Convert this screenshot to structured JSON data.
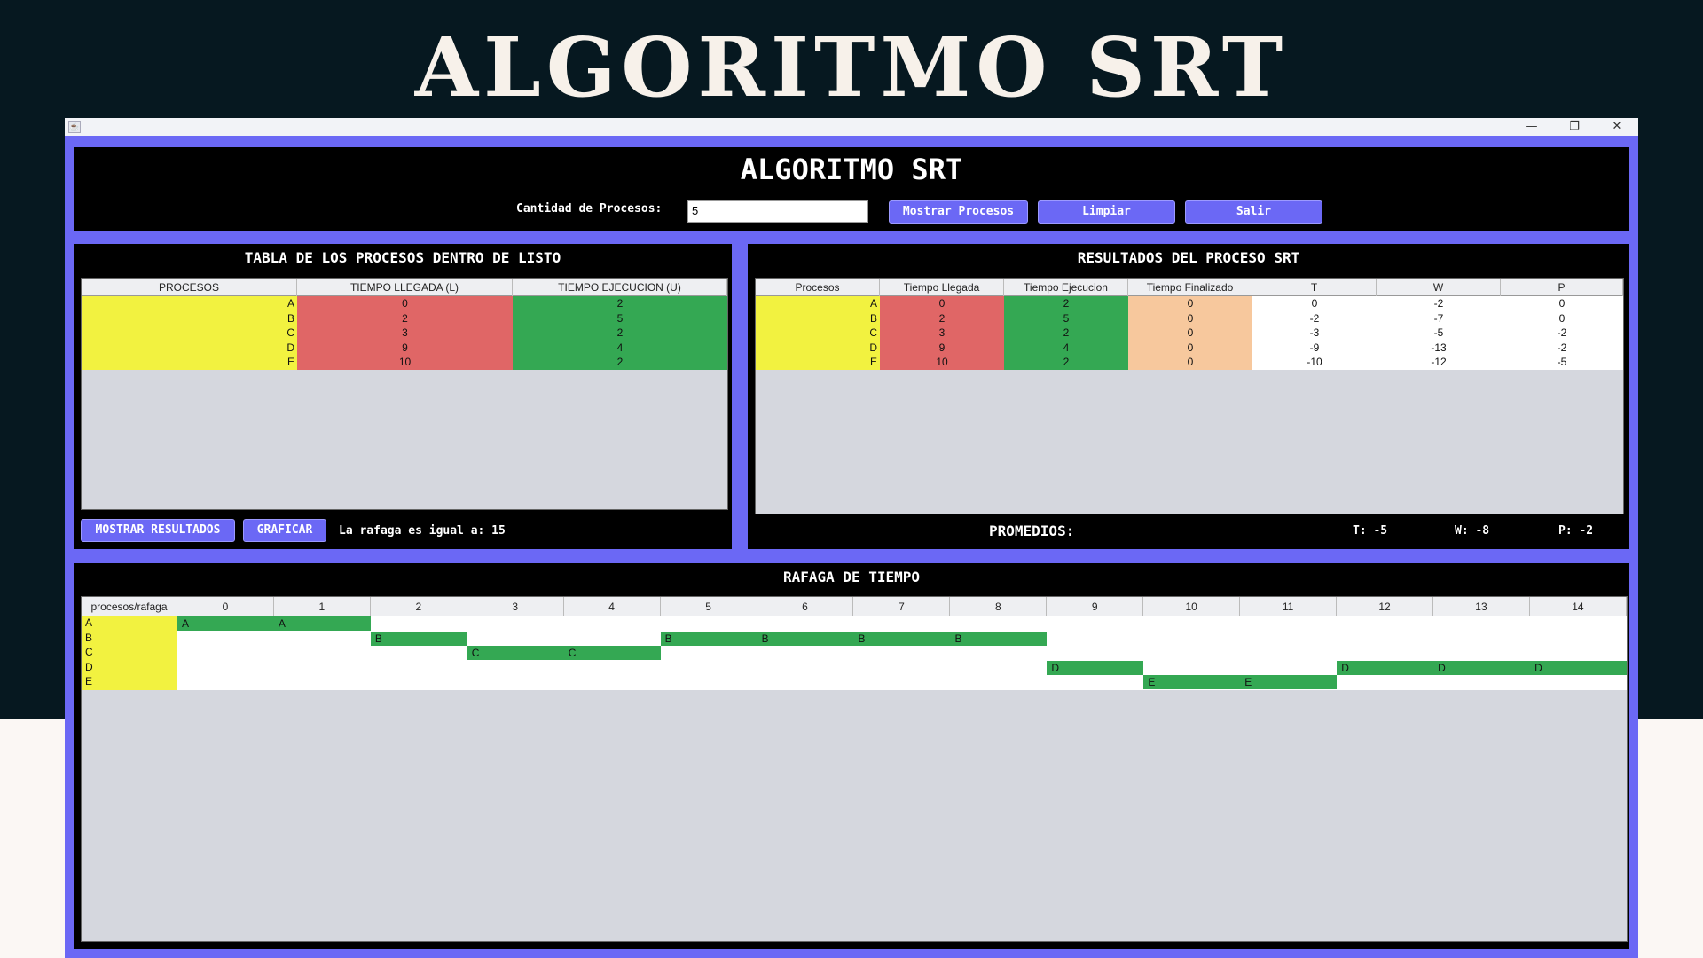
{
  "page_title": "ALGORITMO SRT",
  "window": {
    "minimize_icon": "minimize-icon",
    "restore_icon": "restore-icon",
    "close_icon": "close-icon"
  },
  "header": {
    "title": "ALGORITMO SRT",
    "qty_label": "Cantidad de Procesos:",
    "qty_value": "5",
    "btn_show": "Mostrar Procesos",
    "btn_clear": "Limpiar",
    "btn_exit": "Salir"
  },
  "colors": {
    "accent": "#6b68f5",
    "process": "#f2f240",
    "arrival": "#e06666",
    "execution": "#34a853",
    "finished": "#f7c89d"
  },
  "left_panel": {
    "title": "TABLA DE LOS PROCESOS DENTRO DE LISTO",
    "headers": [
      "PROCESOS",
      "TIEMPO LLEGADA (L)",
      "TIEMPO EJECUCION (U)"
    ],
    "rows": [
      [
        "A",
        "0",
        "2"
      ],
      [
        "B",
        "2",
        "5"
      ],
      [
        "C",
        "3",
        "2"
      ],
      [
        "D",
        "9",
        "4"
      ],
      [
        "E",
        "10",
        "2"
      ]
    ],
    "btn_results": "MOSTRAR RESULTADOS",
    "btn_graph": "GRAFICAR",
    "burst_text": "La rafaga es igual a: 15"
  },
  "right_panel": {
    "title": "RESULTADOS DEL PROCESO SRT",
    "headers": [
      "Procesos",
      "Tiempo Llegada",
      "Tiempo Ejecucion",
      "Tiempo Finalizado",
      "T",
      "W",
      "P"
    ],
    "rows": [
      [
        "A",
        "0",
        "2",
        "0",
        "0",
        "-2",
        "0"
      ],
      [
        "B",
        "2",
        "5",
        "0",
        "-2",
        "-7",
        "0"
      ],
      [
        "C",
        "3",
        "2",
        "0",
        "-3",
        "-5",
        "-2"
      ],
      [
        "D",
        "9",
        "4",
        "0",
        "-9",
        "-13",
        "-2"
      ],
      [
        "E",
        "10",
        "2",
        "0",
        "-10",
        "-12",
        "-5"
      ]
    ],
    "averages_label": "PROMEDIOS:",
    "avg_t": "T: -5",
    "avg_w": "W: -8",
    "avg_p": "P: -2"
  },
  "gantt": {
    "title": "RAFAGA DE TIEMPO",
    "corner_header": "procesos/rafaga",
    "columns": [
      "0",
      "1",
      "2",
      "3",
      "4",
      "5",
      "6",
      "7",
      "8",
      "9",
      "10",
      "11",
      "12",
      "13",
      "14"
    ],
    "processes": [
      "A",
      "B",
      "C",
      "D",
      "E"
    ],
    "schedule": [
      {
        "process": "A",
        "start": 0,
        "end": 2,
        "marks": [
          0,
          1
        ]
      },
      {
        "process": "B",
        "start": 2,
        "end": 3,
        "marks": [
          2
        ]
      },
      {
        "process": "C",
        "start": 3,
        "end": 5,
        "marks": [
          3,
          4
        ]
      },
      {
        "process": "B",
        "start": 5,
        "end": 9,
        "marks": [
          5,
          6,
          7,
          8
        ]
      },
      {
        "process": "D",
        "start": 9,
        "end": 10,
        "marks": [
          9
        ]
      },
      {
        "process": "E",
        "start": 10,
        "end": 12,
        "marks": [
          10,
          11
        ]
      },
      {
        "process": "D",
        "start": 12,
        "end": 15,
        "marks": [
          12,
          13,
          14
        ]
      }
    ]
  }
}
